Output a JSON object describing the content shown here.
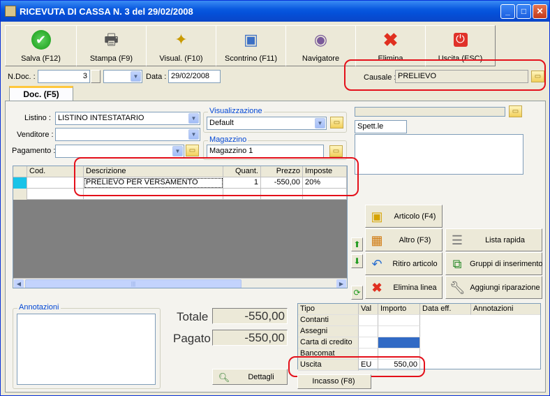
{
  "window": {
    "title": "RICEVUTA DI CASSA N. 3  del 29/02/2008"
  },
  "toolbar": {
    "save": "Salva (F12)",
    "print": "Stampa (F9)",
    "view": "Visual. (F10)",
    "receipt": "Scontrino (F11)",
    "navigator": "Navigatore",
    "delete": "Elimina",
    "exit": "Uscita (ESC)"
  },
  "header": {
    "ndoc_label": "N.Doc. :",
    "ndoc_value": "3",
    "data_label": "Data :",
    "data_value": "29/02/2008",
    "causale_label": "Causale :",
    "causale_value": "PRELIEVO"
  },
  "tab": {
    "label": "Doc. (F5)"
  },
  "form": {
    "listino_label": "Listino :",
    "listino_value": "LISTINO INTESTATARIO",
    "venditore_label": "Venditore :",
    "venditore_value": "",
    "pagamento_label": "Pagamento :",
    "pagamento_value": "",
    "visualizzazione_title": "Visualizzazione",
    "visualizzazione_value": "Default",
    "magazzino_title": "Magazzino",
    "magazzino_value": "Magazzino 1",
    "customer_name": "Spett.le",
    "customer_top": ""
  },
  "lines_grid": {
    "columns": [
      "Cod.",
      "Descrizione",
      "Quant.",
      "Prezzo",
      "Imposte"
    ],
    "rows": [
      {
        "cod": "",
        "descrizione": "PRELIEVO PER VERSAMENTO",
        "quant": "1",
        "prezzo": "-550,00",
        "imposte": "20%"
      }
    ],
    "scroll_thumb": "|||"
  },
  "actions": {
    "articolo": "Articolo (F4)",
    "altro": "Altro (F3)",
    "lista_rapida": "Lista rapida",
    "ritiro": "Ritiro articolo",
    "gruppi": "Gruppi di inserimento",
    "elimina_linea": "Elimina linea",
    "riparazione": "Aggiungi riparazione"
  },
  "notes": {
    "title": "Annotazioni"
  },
  "totals": {
    "totale_label": "Totale",
    "totale_value": "-550,00",
    "pagato_label": "Pagato",
    "pagato_value": "-550,00",
    "dettagli": "Dettagli"
  },
  "payments": {
    "columns": [
      "Tipo",
      "Val",
      "Importo",
      "Data eff.",
      "Annotazioni"
    ],
    "rows": [
      {
        "tipo": "Contanti",
        "val": "",
        "importo": ""
      },
      {
        "tipo": "Assegni",
        "val": "",
        "importo": ""
      },
      {
        "tipo": "Carta di credito",
        "val": "",
        "importo": ""
      },
      {
        "tipo": "Bancomat",
        "val": "",
        "importo": ""
      },
      {
        "tipo": "Uscita",
        "val": "EU",
        "importo": "550,00"
      }
    ],
    "incasso": "Incasso (F8)"
  },
  "colors": {
    "title_bar": "#0a5ae0",
    "highlight": "#e4101a",
    "selection": "#316ac5"
  }
}
